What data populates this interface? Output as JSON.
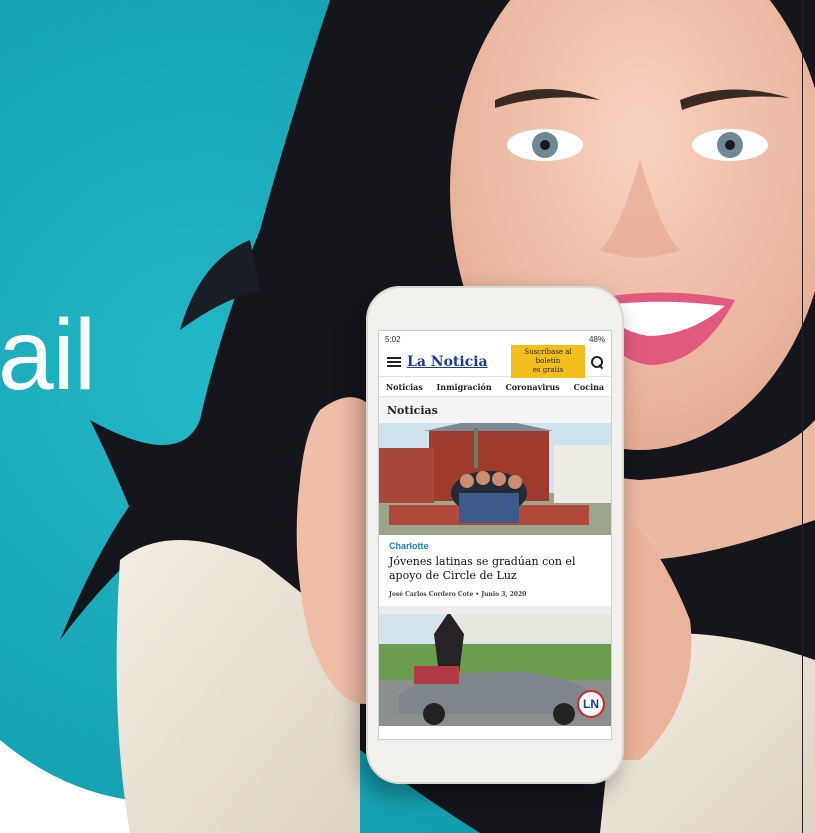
{
  "banner": {
    "headline_fragment": "ail"
  },
  "phone": {
    "status_time": "5:02",
    "status_battery": "48%",
    "logo": "La Noticia",
    "subscribe_line1": "Suscríbase al boletín",
    "subscribe_line2": "es gratis",
    "nav": [
      "Noticias",
      "Inmigración",
      "Coronavirus",
      "Cocina"
    ],
    "section_title": "Noticias",
    "article": {
      "category": "Charlotte",
      "title": "Jóvenes latinas se gradúan con el apoyo de Circle de Luz",
      "author": "José Carlos Cordero Cote",
      "date": "Junio 3, 2020"
    },
    "badge": "LN"
  },
  "colors": {
    "teal_bg": "#19a9b8",
    "logo_blue": "#1a3c8f",
    "subscribe_yellow": "#f2c01c",
    "category_blue": "#1e7fc1"
  }
}
